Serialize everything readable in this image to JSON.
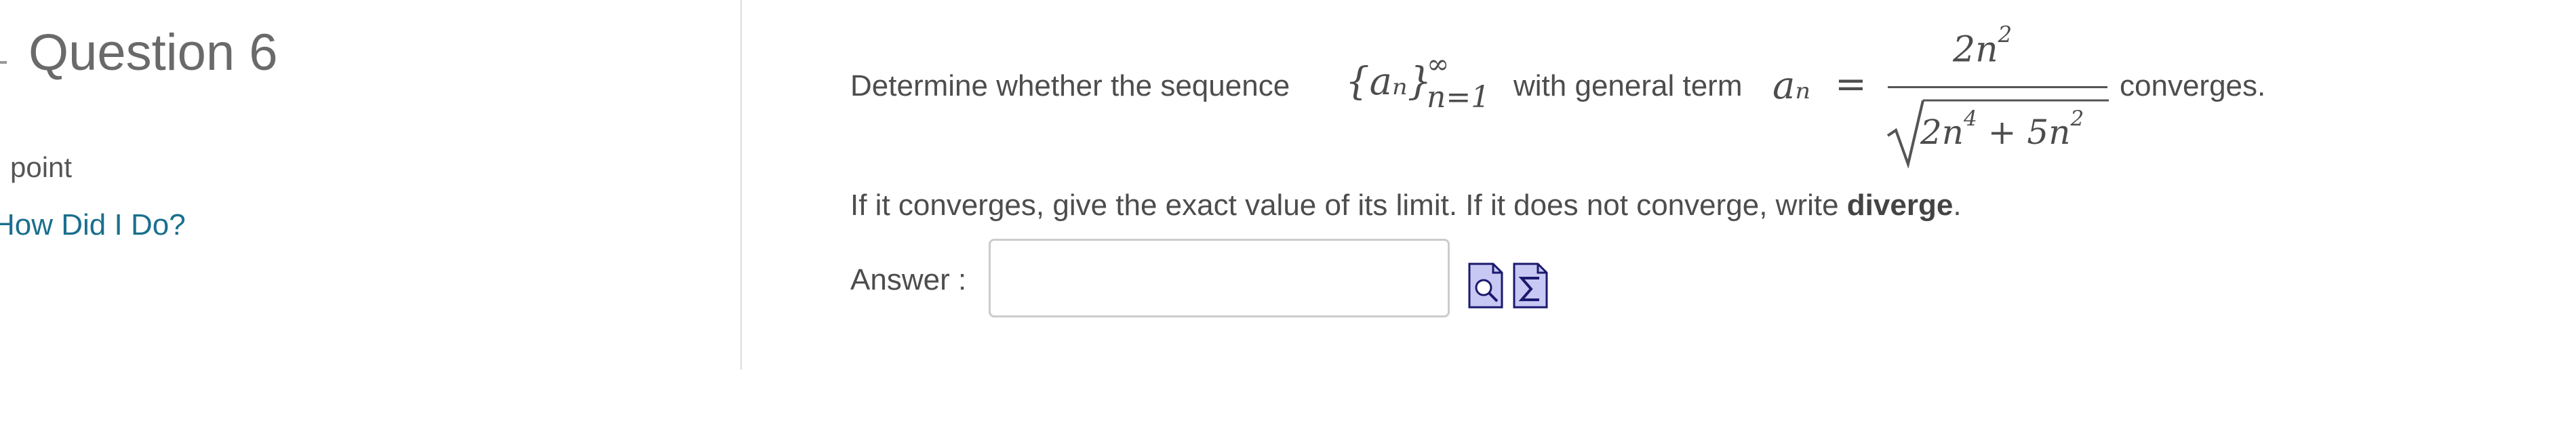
{
  "sidebar": {
    "question_title": "Question 6",
    "points": "point",
    "how_did_i_do": "How Did I Do?"
  },
  "problem": {
    "text_before_sequence": "Determine whether the sequence",
    "sequence_term": "{aₙ}",
    "sequence_upper": "∞",
    "sequence_lower": "n=1",
    "text_middle": "with general term",
    "general_term": "aₙ",
    "equals": "=",
    "numerator": "2n",
    "numerator_exp": "2",
    "denominator_a": "2n",
    "denominator_a_exp": "4",
    "denominator_op": " + 5n",
    "denominator_b_exp": "2",
    "text_after": "converges.",
    "instruction_prefix": "If it converges, give the exact value of its limit. If it does not converge, write ",
    "instruction_keyword": "diverge",
    "instruction_suffix": "."
  },
  "answer": {
    "label": "Answer :",
    "value": "",
    "placeholder": ""
  },
  "icons": {
    "preview": "preview-icon",
    "equation_editor": "equation-editor-icon"
  },
  "colors": {
    "link": "#1a6f8e",
    "icon_fill": "#c8c8f4",
    "icon_stroke": "#1a1a6e"
  }
}
